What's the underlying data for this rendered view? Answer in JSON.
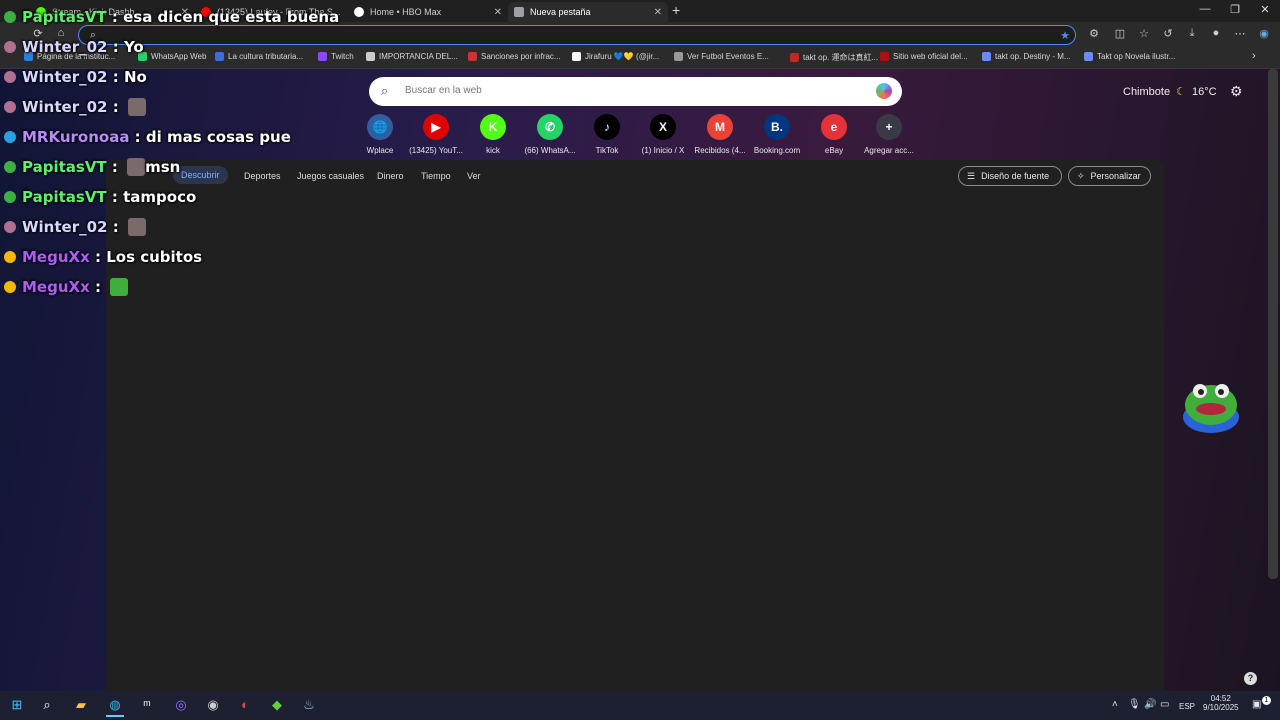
{
  "tabs": [
    {
      "label": "Stream - Kick Dashb...",
      "color": "#53fc18",
      "active": false
    },
    {
      "label": "(13425) Laufey - From The S...",
      "color": "#ff0000",
      "active": false
    },
    {
      "label": "Home • HBO Max",
      "color": "#ffffff",
      "active": false
    },
    {
      "label": "Nueva pestaña",
      "color": "#9aa0a6",
      "active": true
    }
  ],
  "bookmarks": [
    {
      "label": "Página de la instituc...",
      "color": "#2f7fd8"
    },
    {
      "label": "WhatsApp Web",
      "color": "#25d366"
    },
    {
      "label": "La cultura tributaria...",
      "color": "#3a6fd8"
    },
    {
      "label": "Twitch",
      "color": "#9146ff"
    },
    {
      "label": "IMPORTANCIA DEL...",
      "color": "#cccccc"
    },
    {
      "label": "Sanciones por infrac...",
      "color": "#cc3333"
    },
    {
      "label": "Jirafuru 💙💛 (@jir...",
      "color": "#ffffff"
    },
    {
      "label": "Ver Futbol Eventos E...",
      "color": "#999999"
    },
    {
      "label": "takt op. 運命は真紅...",
      "color": "#cc2222"
    },
    {
      "label": "Sitio web oficial del...",
      "color": "#aa1111"
    },
    {
      "label": "takt op. Destiny - M...",
      "color": "#6b8cff"
    },
    {
      "label": "Takt op Novela ilustr...",
      "color": "#6b8cff"
    }
  ],
  "search": {
    "placeholder": "Buscar en la web"
  },
  "weather": {
    "city": "Chimbote",
    "temp": "16°C"
  },
  "quick_access": [
    {
      "label": "Wplace",
      "glyph": "🌐",
      "color": "#2f5fa0"
    },
    {
      "label": "(13425) YouT...",
      "glyph": "▶",
      "color": "#e00000"
    },
    {
      "label": "kick",
      "glyph": "K",
      "color": "#53fc18"
    },
    {
      "label": "(66) WhatsA...",
      "glyph": "✆",
      "color": "#25d366"
    },
    {
      "label": "TikTok",
      "glyph": "♪",
      "color": "#000000"
    },
    {
      "label": "(1) Inicio / X",
      "glyph": "X",
      "color": "#000000"
    },
    {
      "label": "Recibidos (4...",
      "glyph": "M",
      "color": "#ea4335"
    },
    {
      "label": "Booking.com",
      "glyph": "B.",
      "color": "#003580"
    },
    {
      "label": "eBay",
      "glyph": "e",
      "color": "#e53238"
    },
    {
      "label": "Agregar acc...",
      "glyph": "+",
      "color": "#3a3a46"
    }
  ],
  "feed_nav": {
    "active": "Descubrir",
    "items": [
      "Deportes",
      "Juegos casuales",
      "Dinero",
      "Tiempo",
      "Ver"
    ]
  },
  "feed_buttons": {
    "font": "Diseño de fuente",
    "customize": "Personalizar"
  },
  "chat": [
    {
      "user": "PapitasVT",
      "sep": " : ",
      "msg": "esa dicen que esta buena",
      "user_color": "#5ff06f",
      "badge": "#3cb043"
    },
    {
      "user": "Winter_02",
      "sep": " : ",
      "msg": "Yo",
      "user_color": "#d7d7ff",
      "badge": "#b07090"
    },
    {
      "user": "Winter_02",
      "sep": " : ",
      "msg": "No",
      "user_color": "#d7d7ff",
      "badge": "#b07090"
    },
    {
      "user": "Winter_02",
      "sep": " : ",
      "msg": "",
      "user_color": "#d7d7ff",
      "badge": "#b07090"
    },
    {
      "user": "MRKuronoaa",
      "sep": " : ",
      "msg": "di mas cosas pue",
      "user_color": "#b88cff",
      "badge": "#2aa0e0"
    },
    {
      "user": "PapitasVT",
      "sep": " : ",
      "msg": "msn",
      "user_color": "#5ff06f",
      "badge": "#3cb043"
    },
    {
      "user": "PapitasVT",
      "sep": " : ",
      "msg": "tampoco",
      "user_color": "#5ff06f",
      "badge": "#3cb043"
    },
    {
      "user": "Winter_02",
      "sep": " : ",
      "msg": "",
      "user_color": "#d7d7ff",
      "badge": "#b07090"
    },
    {
      "user": "MeguXx",
      "sep": " : ",
      "msg": "Los cubitos",
      "user_color": "#b15cff",
      "badge": "#f5b800"
    },
    {
      "user": "MeguXx",
      "sep": " : ",
      "msg": "",
      "user_color": "#b15cff",
      "badge": "#f5b800"
    }
  ],
  "taskbar": {
    "lang": "ESP",
    "time": "04:52",
    "date": "9/10/2025",
    "notifications": "1"
  }
}
